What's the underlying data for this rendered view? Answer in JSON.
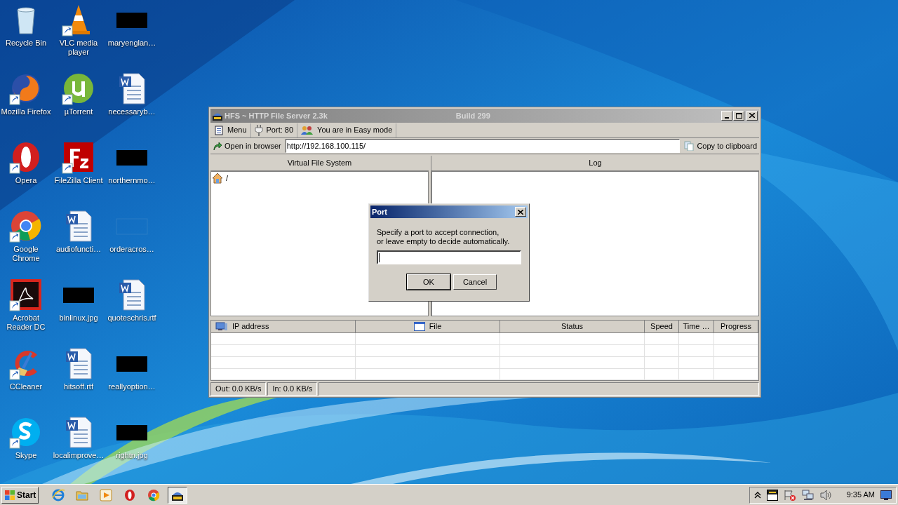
{
  "desktop_icons": [
    {
      "label": "Recycle Bin",
      "kind": "recycle",
      "shortcut": false
    },
    {
      "label": "VLC media player",
      "kind": "vlc",
      "shortcut": true
    },
    {
      "label": "maryenglan…",
      "kind": "hidden",
      "shortcut": false
    },
    {
      "label": "Mozilla Firefox",
      "kind": "firefox",
      "shortcut": true
    },
    {
      "label": "µTorrent",
      "kind": "utorrent",
      "shortcut": true
    },
    {
      "label": "necessaryb…",
      "kind": "word",
      "shortcut": false
    },
    {
      "label": "Opera",
      "kind": "opera",
      "shortcut": true
    },
    {
      "label": "FileZilla Client",
      "kind": "filezilla",
      "shortcut": true
    },
    {
      "label": "northernmo…",
      "kind": "hidden",
      "shortcut": false
    },
    {
      "label": "Google Chrome",
      "kind": "chrome",
      "shortcut": true
    },
    {
      "label": "audiofuncti…",
      "kind": "word",
      "shortcut": false
    },
    {
      "label": "orderacros…",
      "kind": "blank",
      "shortcut": false
    },
    {
      "label": "Acrobat Reader DC",
      "kind": "acrobat",
      "shortcut": true
    },
    {
      "label": "binlinux.jpg",
      "kind": "hidden",
      "shortcut": false
    },
    {
      "label": "quoteschris.rtf",
      "kind": "word",
      "shortcut": false
    },
    {
      "label": "CCleaner",
      "kind": "ccleaner",
      "shortcut": true
    },
    {
      "label": "hitsoff.rtf",
      "kind": "word",
      "shortcut": false
    },
    {
      "label": "reallyoption…",
      "kind": "hidden",
      "shortcut": false
    },
    {
      "label": "Skype",
      "kind": "skype",
      "shortcut": true
    },
    {
      "label": "localimprove…",
      "kind": "word",
      "shortcut": false
    },
    {
      "label": "rightn.jpg",
      "kind": "hidden",
      "shortcut": false
    }
  ],
  "hfs_window": {
    "title": "HFS ~ HTTP File Server 2.3k",
    "build": "Build 299",
    "toolbar": [
      {
        "label": "Menu",
        "kind": "menu"
      },
      {
        "label": "Port: 80",
        "kind": "port"
      },
      {
        "label": "You are in Easy mode",
        "kind": "mode"
      }
    ],
    "open_in_browser": "Open in browser",
    "url": "http://192.168.100.115/",
    "copy_to_clipboard": "Copy to clipboard",
    "vfs_header": "Virtual File System",
    "vfs_root": "/",
    "log_header": "Log",
    "columns": [
      {
        "label": "IP address",
        "kind": "computer"
      },
      {
        "label": "File",
        "kind": "window"
      },
      {
        "label": "Status",
        "kind": "plain"
      },
      {
        "label": "Speed",
        "kind": "plain"
      },
      {
        "label": "Time …",
        "kind": "plain"
      },
      {
        "label": "Progress",
        "kind": "plain"
      }
    ],
    "status": [
      "Out: 0.0 KB/s",
      "In: 0.0 KB/s"
    ]
  },
  "dialog": {
    "title": "Port",
    "message_lines": [
      "Specify a port to accept connection,",
      "or leave empty to decide automatically."
    ],
    "buttons": [
      {
        "label": "OK",
        "default": true
      },
      {
        "label": "Cancel",
        "default": false
      }
    ]
  },
  "taskbar": {
    "start": "Start",
    "apps": [
      {
        "kind": "ie",
        "selected": false
      },
      {
        "kind": "folder",
        "selected": false
      },
      {
        "kind": "media",
        "selected": false
      },
      {
        "kind": "opera",
        "selected": false
      },
      {
        "kind": "chrome",
        "selected": false
      },
      {
        "kind": "hfs",
        "selected": true
      }
    ],
    "tray": [
      {
        "kind": "arrow"
      },
      {
        "kind": "hfs"
      },
      {
        "kind": "flag"
      },
      {
        "kind": "network"
      },
      {
        "kind": "speaker"
      }
    ],
    "time": "9:35 AM"
  }
}
